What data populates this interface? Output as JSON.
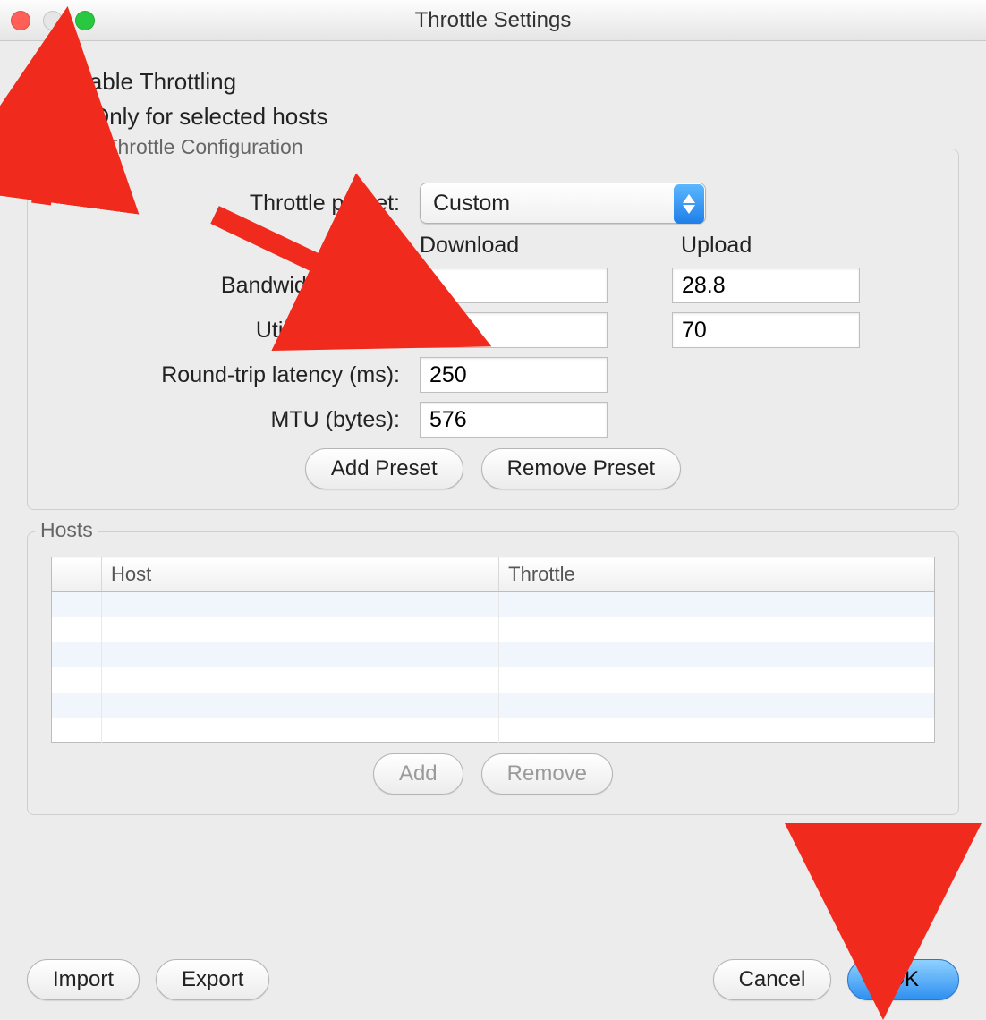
{
  "title": "Throttle Settings",
  "checkboxes": {
    "enable_throttling": {
      "label": "Enable Throttling",
      "checked": true
    },
    "only_selected": {
      "label": "Only for selected hosts",
      "checked": false
    }
  },
  "global": {
    "group_title": "Global Throttle Configuration",
    "preset_label": "Throttle preset:",
    "preset_value": "Custom",
    "column_download": "Download",
    "column_upload": "Upload",
    "bandwidth_label": "Bandwidth (kbps):",
    "bandwidth_download": "1",
    "bandwidth_upload": "28.8",
    "utilisation_label": "Utilisation (%):",
    "utilisation_download": "70",
    "utilisation_upload": "70",
    "rtt_label": "Round-trip latency (ms):",
    "rtt_value": "250",
    "mtu_label": "MTU (bytes):",
    "mtu_value": "576",
    "btn_add_preset": "Add Preset",
    "btn_remove_preset": "Remove Preset"
  },
  "hosts": {
    "group_title": "Hosts",
    "col_host": "Host",
    "col_throttle": "Throttle",
    "btn_add": "Add",
    "btn_remove": "Remove"
  },
  "footer": {
    "import": "Import",
    "export": "Export",
    "cancel": "Cancel",
    "ok": "OK"
  }
}
